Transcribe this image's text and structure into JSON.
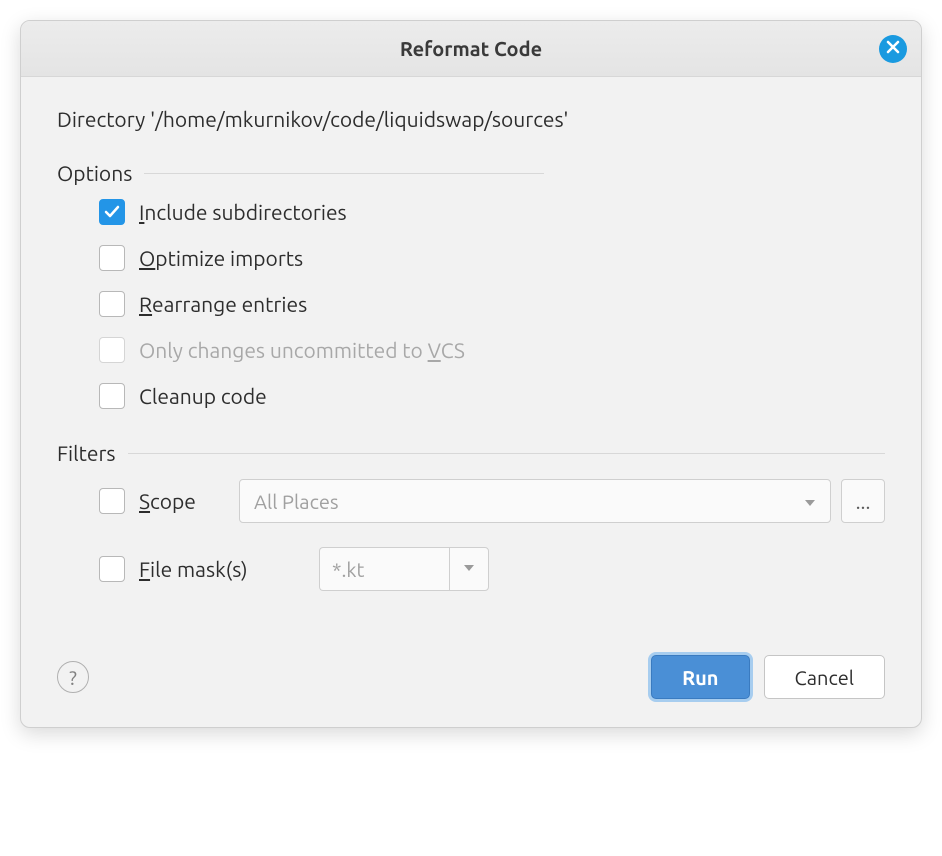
{
  "title": "Reformat Code",
  "directory": "Directory '/home/mkurnikov/code/liquidswap/sources'",
  "sections": {
    "options_title": "Options",
    "filters_title": "Filters"
  },
  "options": {
    "include_subdirs": {
      "label_prefix": "I",
      "label_rest": "nclude subdirectories",
      "checked": true,
      "enabled": true
    },
    "optimize_imports": {
      "label_prefix": "O",
      "label_rest": "ptimize imports",
      "checked": false,
      "enabled": true
    },
    "rearrange_entries": {
      "label_prefix": "R",
      "label_rest": "earrange entries",
      "checked": false,
      "enabled": true
    },
    "only_vcs": {
      "label_before": "Only changes uncommitted to ",
      "label_underline": "V",
      "label_after": "CS",
      "checked": false,
      "enabled": false
    },
    "cleanup_code": {
      "label": "Cleanup code",
      "checked": false,
      "enabled": true
    }
  },
  "filters": {
    "scope": {
      "label_prefix": "S",
      "label_rest": "cope",
      "checked": false,
      "value": "All Places"
    },
    "file_mask": {
      "label_prefix": "F",
      "label_rest": "ile mask(s)",
      "checked": false,
      "placeholder": "*.kt"
    }
  },
  "buttons": {
    "ellipsis": "...",
    "help": "?",
    "run": "Run",
    "cancel": "Cancel"
  }
}
